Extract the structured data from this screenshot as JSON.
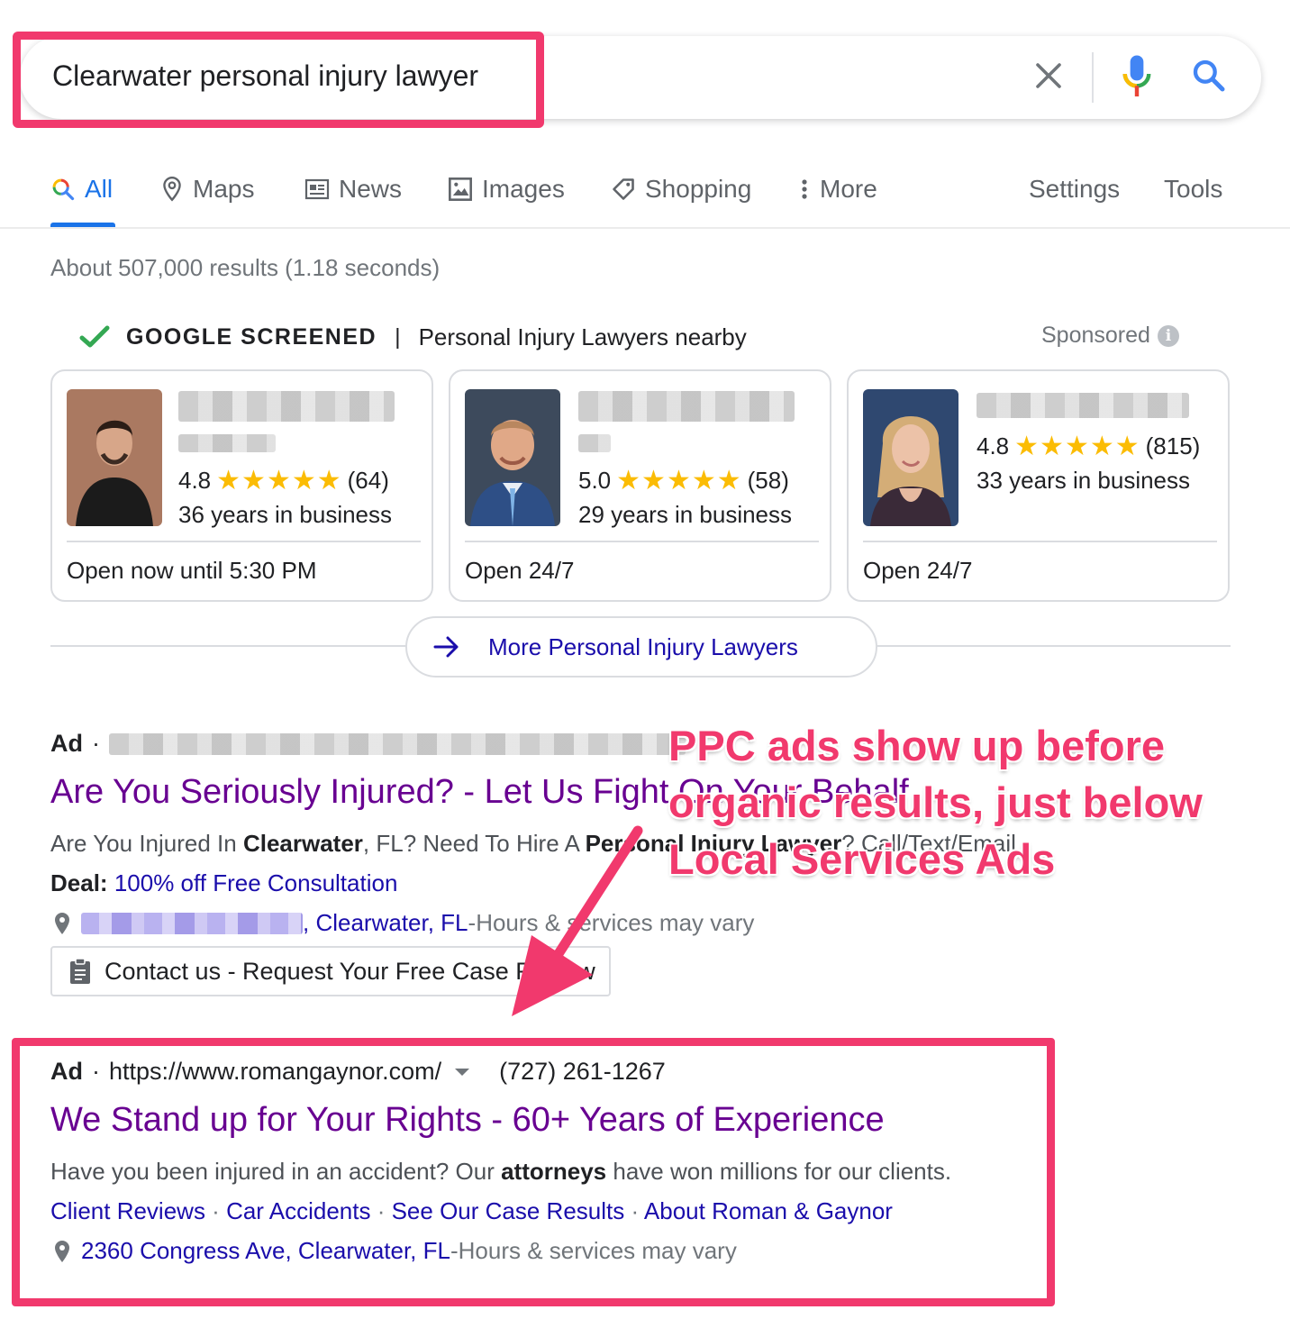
{
  "search": {
    "query": "Clearwater personal injury lawyer"
  },
  "tabs": [
    {
      "label": "All"
    },
    {
      "label": "Maps"
    },
    {
      "label": "News"
    },
    {
      "label": "Images"
    },
    {
      "label": "Shopping"
    },
    {
      "label": "More"
    },
    {
      "label": "Settings"
    },
    {
      "label": "Tools"
    }
  ],
  "results_stats": "About 507,000 results (1.18 seconds)",
  "lsa": {
    "badge": "GOOGLE SCREENED",
    "separator": "|",
    "subtitle": "Personal Injury Lawyers nearby",
    "sponsored": "Sponsored",
    "info_glyph": "i",
    "stars_glyph": "★★★★★",
    "cards": [
      {
        "rating": "4.8",
        "reviews": "(64)",
        "years": "36 years in business",
        "hours": "Open now until 5:30 PM"
      },
      {
        "rating": "5.0",
        "reviews": "(58)",
        "years": "29 years in business",
        "hours": "Open 24/7"
      },
      {
        "rating": "4.8",
        "reviews": "(815)",
        "years": "33 years in business",
        "hours": "Open 24/7"
      }
    ],
    "more_button": "More Personal Injury Lawyers"
  },
  "ad1": {
    "label": "Ad",
    "dot": "·",
    "title": "Are You Seriously Injured? - Let Us Fight On Your Behalf",
    "desc_start": "Are You Injured In ",
    "desc_bold1": "Clearwater",
    "desc_mid": ", FL? Need To Hire A ",
    "desc_bold2": "Personal Injury Lawyer",
    "desc_end": "? Call/Text/Email",
    "deal_label": "Deal:",
    "deal_text": "100% off Free Consultation",
    "location": ", Clearwater, FL",
    "location_sep": " - ",
    "location_note": "Hours & services may vary",
    "extension": "Contact us - Request Your Free Case Review"
  },
  "ad2": {
    "label": "Ad",
    "dot": "·",
    "url": "https://www.romangaynor.com/",
    "phone": "(727) 261-1267",
    "title": "We Stand up for Your Rights - 60+ Years of Experience",
    "desc_start": "Have you been injured in an accident? Our ",
    "desc_bold": "attorneys",
    "desc_end": " have won millions for our clients.",
    "sitelink_sep": " · ",
    "sitelinks": [
      "Client Reviews",
      "Car Accidents",
      "See Our Case Results",
      "About Roman & Gaynor"
    ],
    "address": "2360 Congress Ave, Clearwater, FL",
    "address_sep": " - ",
    "address_note": "Hours & services may vary"
  },
  "annotation": {
    "text": "PPC ads show up before organic results, just below Local Services Ads",
    "color": "#f1396d"
  },
  "colors": {
    "accent": "#1a73e8",
    "ad_title": "#680091",
    "link": "#1a0dab",
    "highlight": "#f1396d",
    "star": "#fbbc04"
  }
}
